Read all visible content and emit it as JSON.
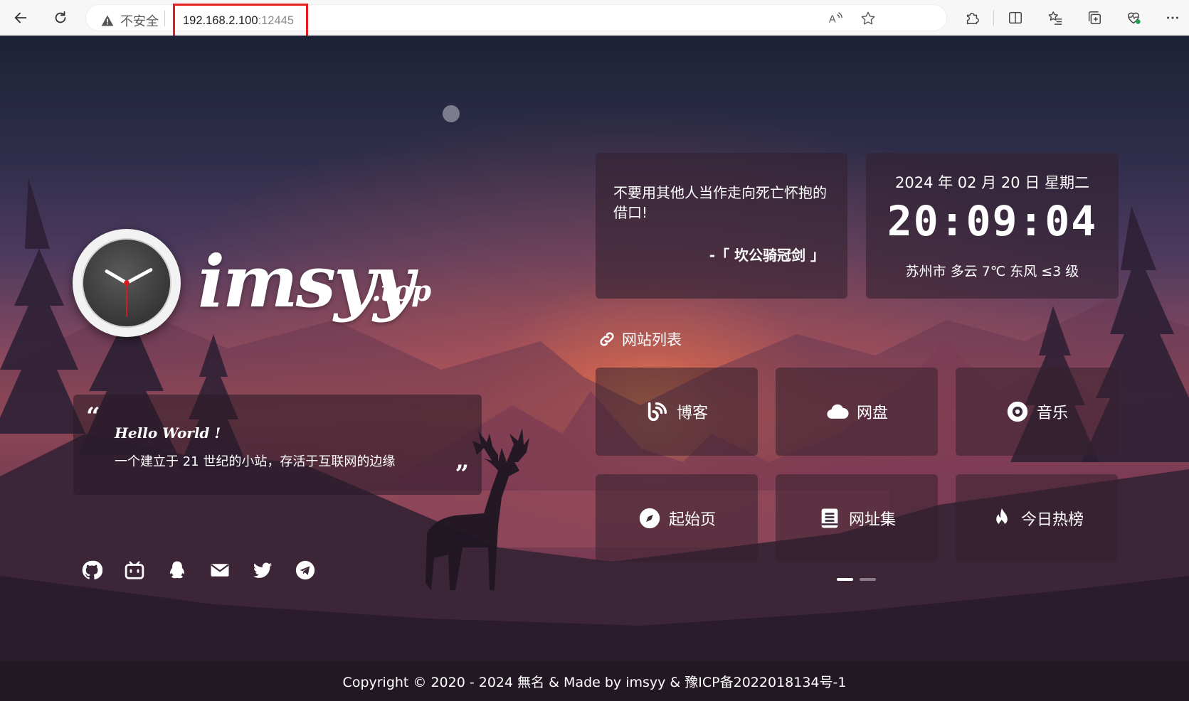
{
  "browser": {
    "security_label": "不安全",
    "url_host": "192.168.2.100",
    "url_port": ":12445"
  },
  "brand": {
    "logo_text": "imsyy",
    "logo_tld": ".top"
  },
  "motto": {
    "hello": "Hello World !",
    "text": "一个建立于 21 世纪的小站，存活于互联网的边缘"
  },
  "socials": [
    "github-icon",
    "bilibili-icon",
    "qq-icon",
    "email-icon",
    "twitter-icon",
    "telegram-icon"
  ],
  "quote": {
    "text": "不要用其他人当作走向死亡怀抱的借口!",
    "from": "-「 坎公骑冠剑 」"
  },
  "time": {
    "date": "2024 年 02 月 20 日 星期二",
    "clock": "20:09:04",
    "weather": "苏州市 多云 7℃ 东风 ≤3 级"
  },
  "sites": {
    "title": "网站列表",
    "items": [
      {
        "label": "博客",
        "icon": "blog-icon"
      },
      {
        "label": "网盘",
        "icon": "cloud-icon"
      },
      {
        "label": "音乐",
        "icon": "music-icon"
      },
      {
        "label": "起始页",
        "icon": "compass-icon"
      },
      {
        "label": "网址集",
        "icon": "book-icon"
      },
      {
        "label": "今日热榜",
        "icon": "fire-icon"
      }
    ],
    "pages": 2,
    "current_page": 1
  },
  "footer": {
    "text": "Copyright © 2020 - 2024 無名 & Made by imsyy & 豫ICP备2022018134号-1"
  }
}
